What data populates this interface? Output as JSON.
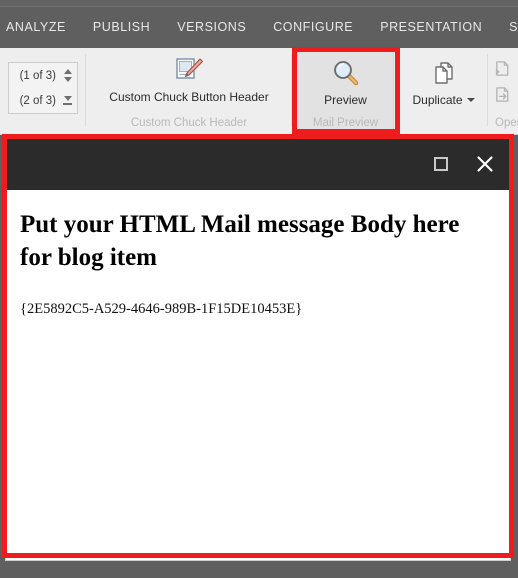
{
  "ribbon": {
    "tabs": [
      {
        "label": "ANALYZE",
        "name": "tab-analyze"
      },
      {
        "label": "PUBLISH",
        "name": "tab-publish"
      },
      {
        "label": "VERSIONS",
        "name": "tab-versions"
      },
      {
        "label": "CONFIGURE",
        "name": "tab-configure"
      },
      {
        "label": "PRESENTATION",
        "name": "tab-presentation"
      },
      {
        "label": "SECURITY",
        "name": "tab-security"
      }
    ],
    "pager": {
      "row1_value": "(1 of 3)",
      "row2_value": "(2 of 3)"
    },
    "groups": {
      "chuck": {
        "group_label": "Custom Chuck Header",
        "button_label": "Custom Chuck Button Header",
        "icon": "page-pencil-edit-icon"
      },
      "preview": {
        "group_label": "Mail Preview",
        "button_label": "Preview",
        "icon": "magnifier-icon"
      },
      "duplicate": {
        "button_label": "Duplicate",
        "icon": "copy-documents-icon"
      },
      "open": {
        "group_label": "Open",
        "item1_label": "",
        "item2_label": ""
      }
    }
  },
  "dialog": {
    "title": "",
    "maximize_label": "□",
    "close_label": "×",
    "heading": "Put your HTML Mail message Body here for blog item",
    "guid": "{2E5892C5-A529-4646-989B-1F15DE10453E}"
  },
  "annotations": {
    "color": "#EE1C1C",
    "preview_box": "highlight around Preview button",
    "dialog_box": "highlight around mail preview dialog"
  },
  "colors": {
    "ribbon_bg": "#EEEEEE",
    "tabbar_bg": "#5F5F5F",
    "titlebar_bg": "#2B2B2B",
    "annotation_red": "#EE1C1C"
  }
}
